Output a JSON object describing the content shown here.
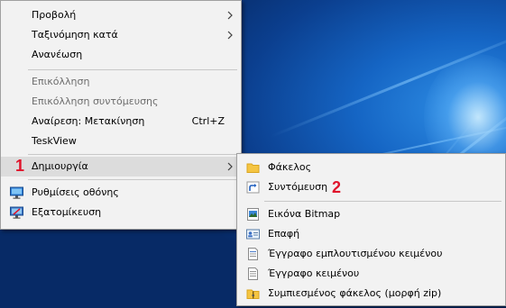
{
  "context_menu": {
    "items": [
      {
        "label": "Προβολή"
      },
      {
        "label": "Ταξινόμηση κατά"
      },
      {
        "label": "Ανανέωση"
      },
      {
        "label": "Επικόλληση"
      },
      {
        "label": "Επικόλληση συντόμευσης"
      },
      {
        "label": "Αναίρεση: Μετακίνηση",
        "shortcut": "Ctrl+Z"
      },
      {
        "label": "TeskView"
      },
      {
        "label": "Δημιουργία"
      },
      {
        "label": "Ρυθμίσεις οθόνης",
        "icon": "display-settings-icon"
      },
      {
        "label": "Εξατομίκευση",
        "icon": "personalize-icon"
      }
    ]
  },
  "new_submenu": {
    "items": [
      {
        "label": "Φάκελος",
        "icon": "folder-icon"
      },
      {
        "label": "Συντόμευση",
        "icon": "shortcut-icon"
      },
      {
        "label": "Εικόνα Bitmap",
        "icon": "bitmap-icon"
      },
      {
        "label": "Επαφή",
        "icon": "contact-icon"
      },
      {
        "label": "Έγγραφο εμπλουτισμένου κειμένου",
        "icon": "rich-text-document-icon"
      },
      {
        "label": "Έγγραφο κειμένου",
        "icon": "text-document-icon"
      },
      {
        "label": "Συμπιεσμένος φάκελος (μορφή zip)",
        "icon": "zip-folder-icon"
      }
    ]
  },
  "annotations": {
    "step1": "1",
    "step2": "2"
  },
  "colors": {
    "annotation": "#e0142b",
    "menu_bg": "#f2f2f2",
    "highlight": "#dcdcdc",
    "desktop": "#0b3f8f"
  }
}
